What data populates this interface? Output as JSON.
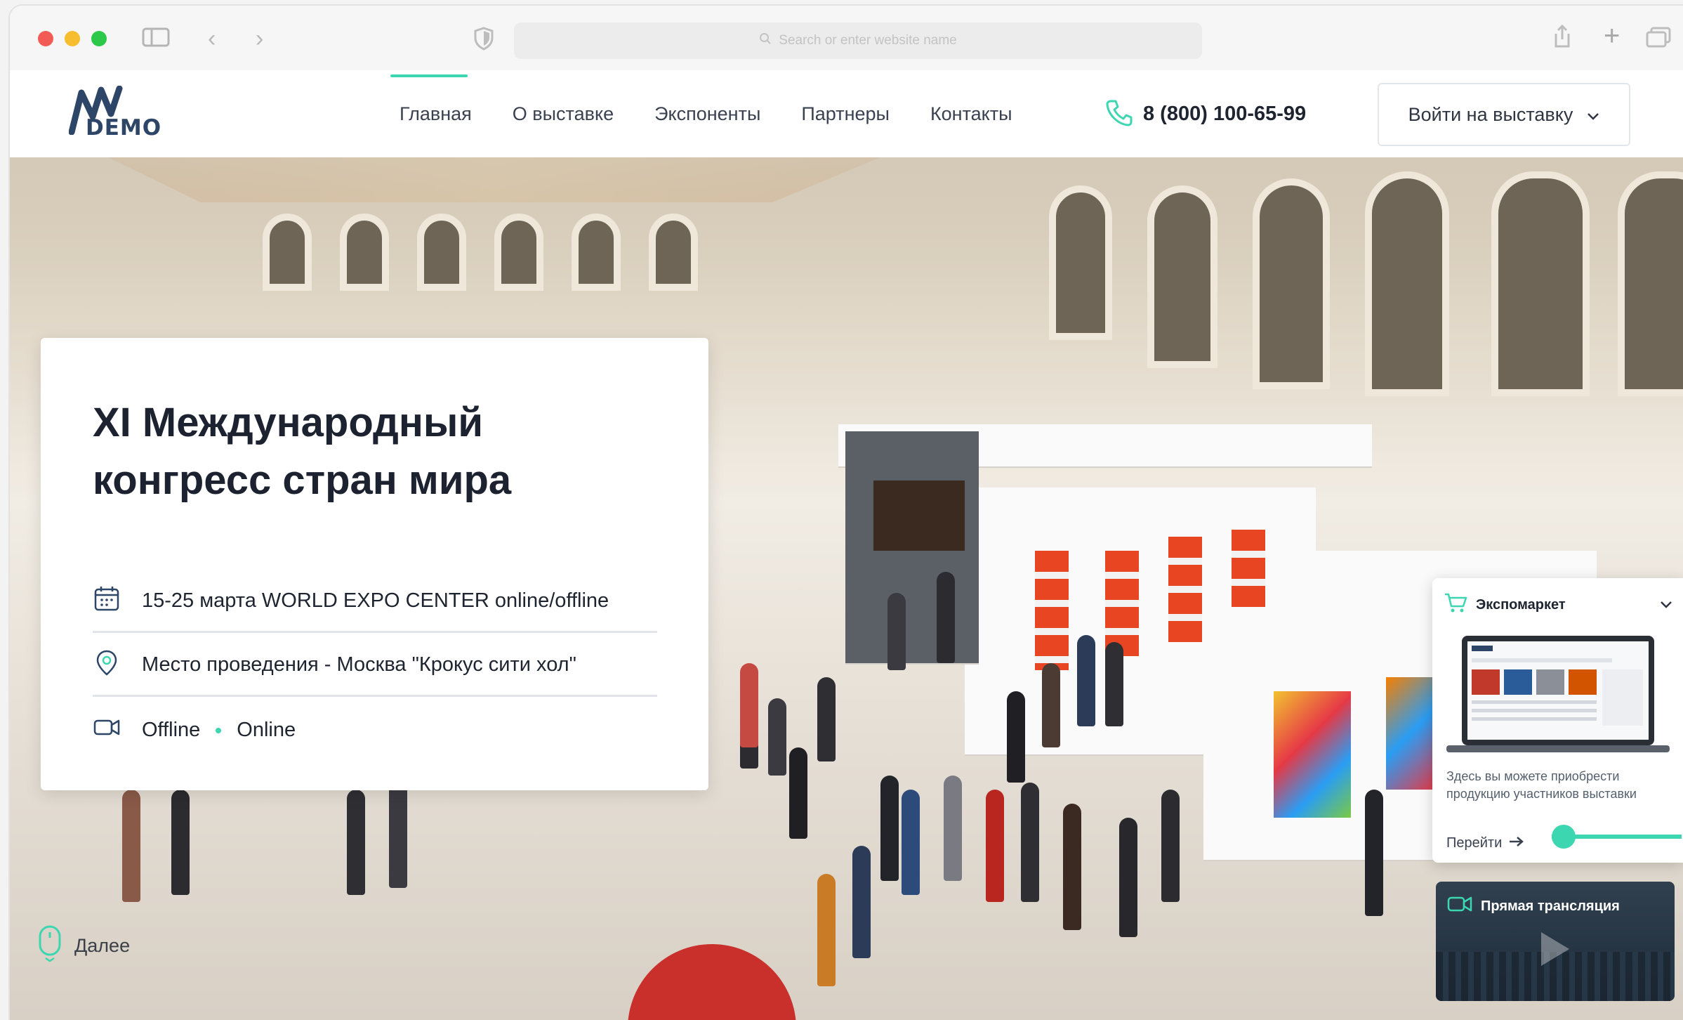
{
  "browser": {
    "url_placeholder": "Search or enter website name"
  },
  "header": {
    "logo_text": "DEMO",
    "nav": [
      {
        "label": "Главная",
        "active": true
      },
      {
        "label": "О выставке",
        "active": false
      },
      {
        "label": "Экспоненты",
        "active": false
      },
      {
        "label": "Партнеры",
        "active": false
      },
      {
        "label": "Контакты",
        "active": false
      }
    ],
    "phone": "8 (800) 100-65-99",
    "login_label": "Войти на выставку"
  },
  "hero": {
    "title": "XI Международный конгресс стран мира",
    "date_line": "15-25 марта WORLD EXPO CENTER online/offline",
    "place_line": "Место проведения - Москва \"Крокус сити хол\"",
    "format_offline": "Offline",
    "format_online": "Online",
    "scroll_label": "Далее"
  },
  "expomarket": {
    "title": "Экспомаркет",
    "description": "Здесь вы можете приобрести продукцию участников выставки",
    "link_label": "Перейти"
  },
  "stream": {
    "title": "Прямая трансляция"
  },
  "colors": {
    "accent": "#3cd6b0",
    "text_dark": "#1e2430",
    "logo": "#2d4566"
  }
}
